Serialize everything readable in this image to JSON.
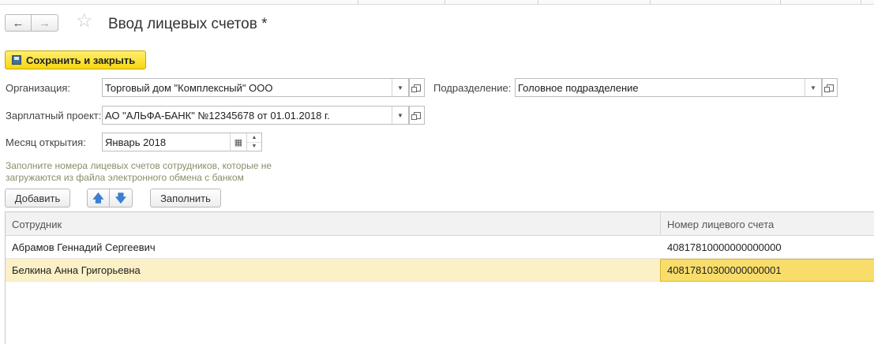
{
  "window": {
    "title": "Ввод лицевых счетов *"
  },
  "nav": {
    "back_icon": "arrow-left-icon",
    "forward_icon": "arrow-right-icon",
    "favorite_icon": "star-icon"
  },
  "toolbar": {
    "save_close_label": "Сохранить и закрыть"
  },
  "form": {
    "organization": {
      "label": "Организация:",
      "value": "Торговый дом \"Комплексный\" ООО"
    },
    "department": {
      "label": "Подразделение:",
      "value": "Головное подразделение"
    },
    "salary_project": {
      "label": "Зарплатный проект:",
      "value": "АО \"АЛЬФА-БАНК\" №12345678 от 01.01.2018 г."
    },
    "open_month": {
      "label": "Месяц открытия:",
      "value": "Январь 2018"
    }
  },
  "hint": "Заполните номера лицевых счетов сотрудников, которые не загружаются из файла электронного обмена с банком",
  "table_toolbar": {
    "add_label": "Добавить",
    "fill_label": "Заполнить"
  },
  "table": {
    "columns": [
      "Сотрудник",
      "Номер лицевого счета"
    ],
    "rows": [
      [
        "Абрамов Геннадий Сергеевич",
        "40817810000000000000"
      ],
      [
        "Белкина Анна Григорьевна",
        "40817810300000000001"
      ]
    ],
    "selected_row": 1
  },
  "colors": {
    "save_button": "#f7d613",
    "selected_row": "#fbf0c6",
    "active_cell": "#f9dd6b",
    "arrow": "#3d7fd0",
    "hint_text": "#8c8c6a"
  }
}
